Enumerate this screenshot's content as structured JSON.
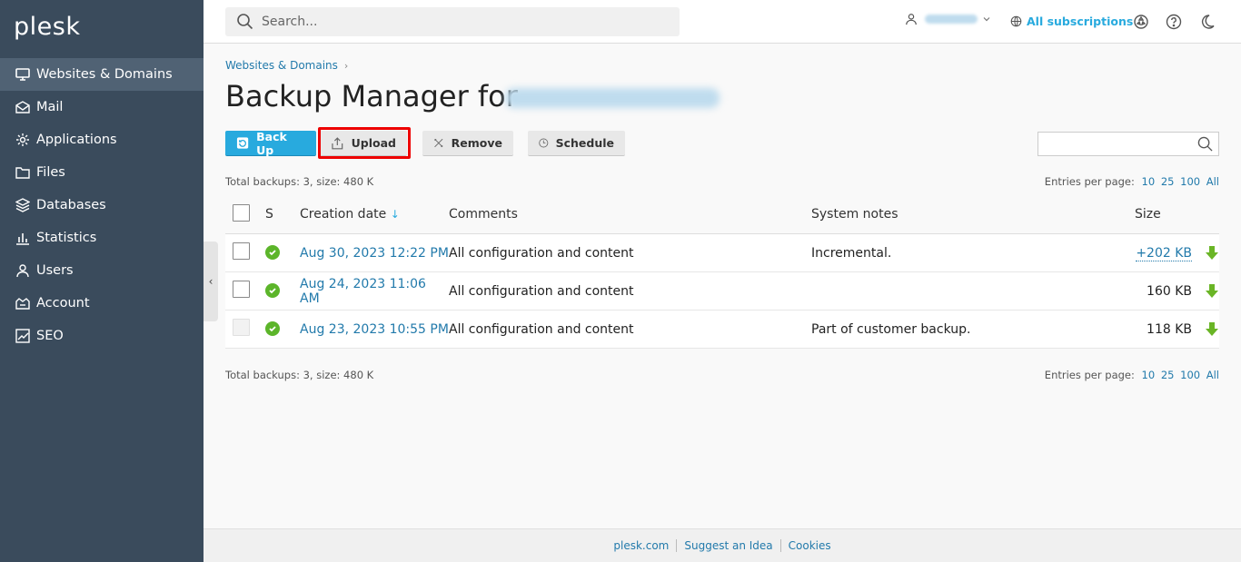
{
  "sidebar": {
    "logo": "plesk",
    "items": [
      {
        "label": "Websites & Domains",
        "icon": "monitor-icon",
        "active": true
      },
      {
        "label": "Mail",
        "icon": "mail-icon"
      },
      {
        "label": "Applications",
        "icon": "gear-icon"
      },
      {
        "label": "Files",
        "icon": "folder-icon"
      },
      {
        "label": "Databases",
        "icon": "database-icon"
      },
      {
        "label": "Statistics",
        "icon": "bar-chart-icon"
      },
      {
        "label": "Users",
        "icon": "user-icon"
      },
      {
        "label": "Account",
        "icon": "account-icon"
      },
      {
        "label": "SEO",
        "icon": "seo-icon"
      }
    ]
  },
  "header": {
    "search_placeholder": "Search...",
    "subscriptions_label": "All subscriptions"
  },
  "breadcrumb": {
    "item": "Websites & Domains"
  },
  "page": {
    "title": "Backup Manager for"
  },
  "toolbar": {
    "backup_label": "Back Up",
    "upload_label": "Upload",
    "remove_label": "Remove",
    "schedule_label": "Schedule"
  },
  "summary": {
    "text": "Total backups: 3, size: 480 K",
    "entries_label": "Entries per page:",
    "options": [
      "10",
      "25",
      "100",
      "All"
    ]
  },
  "table": {
    "headers": {
      "s": "S",
      "date": "Creation date",
      "comments": "Comments",
      "notes": "System notes",
      "size": "Size"
    },
    "rows": [
      {
        "date": "Aug 30, 2023 12:22 PM",
        "comment": "All configuration and content",
        "notes": "Incremental.",
        "size": "+202 KB"
      },
      {
        "date": "Aug 24, 2023 11:06 AM",
        "comment": "All configuration and content",
        "notes": "",
        "size": "160 KB"
      },
      {
        "date": "Aug 23, 2023 10:55 PM",
        "comment": "All configuration and content",
        "notes": "Part of customer backup.",
        "size": "118 KB"
      }
    ]
  },
  "footer": {
    "link1": "plesk.com",
    "link2": "Suggest an Idea",
    "link3": "Cookies"
  },
  "colors": {
    "accent": "#28aade",
    "sidebar": "#3a4b5c",
    "success": "#5cb52a",
    "highlight": "#e00000"
  }
}
